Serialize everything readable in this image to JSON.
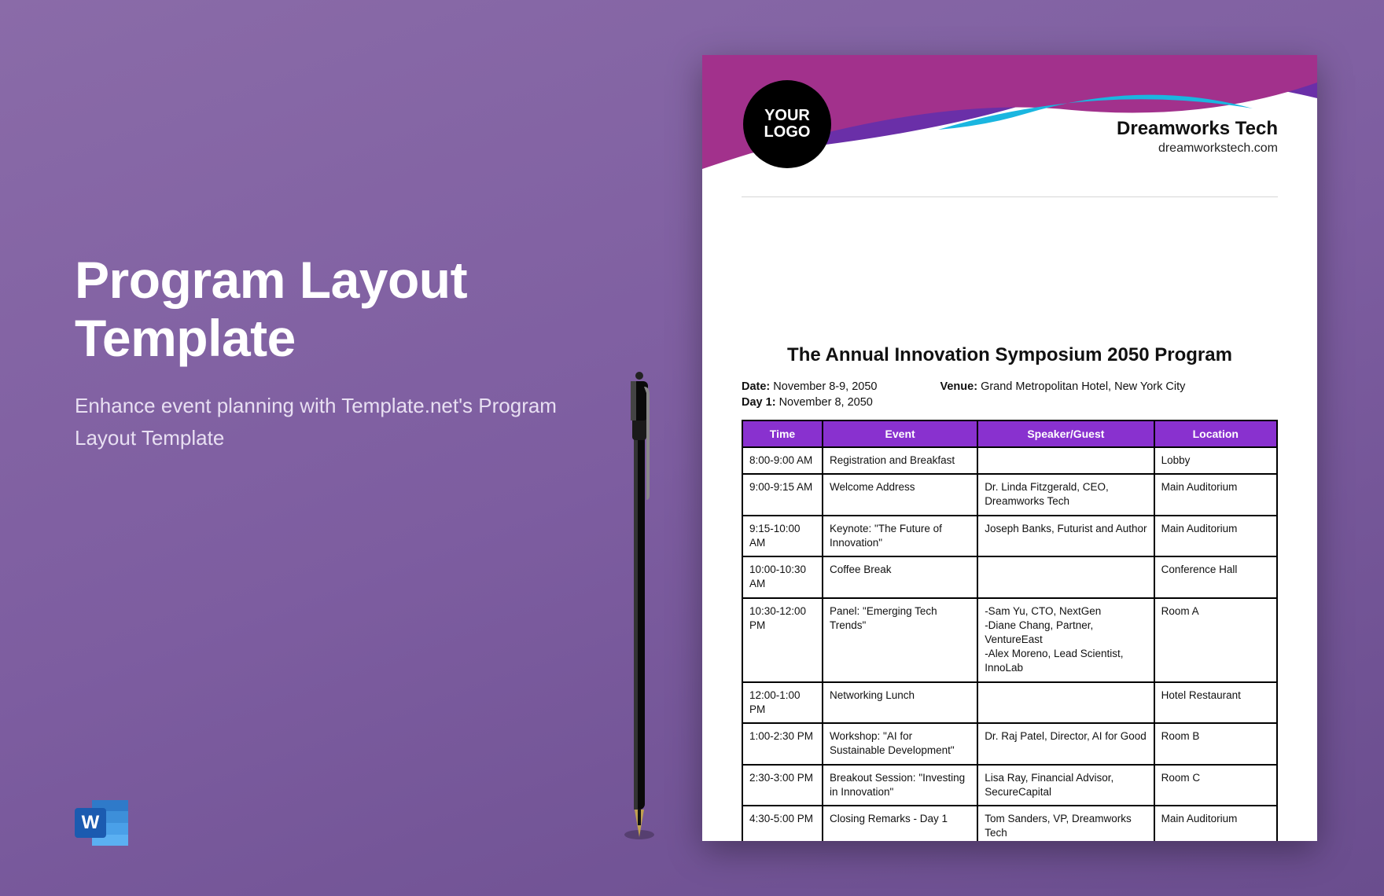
{
  "hero": {
    "title": "Program Layout Template",
    "subtitle": "Enhance event planning with Template.net's Program Layout Template"
  },
  "logo_placeholder": {
    "line1": "YOUR",
    "line2": "LOGO"
  },
  "company": {
    "name": "Dreamworks Tech",
    "site": "dreamworkstech.com"
  },
  "doc": {
    "title": "The Annual Innovation Symposium 2050 Program",
    "date_label": "Date:",
    "date_value": "November 8-9, 2050",
    "venue_label": "Venue:",
    "venue_value": "Grand Metropolitan Hotel, New York City",
    "day_label": "Day 1:",
    "day_value": "November 8, 2050"
  },
  "table": {
    "headers": {
      "time": "Time",
      "event": "Event",
      "speaker": "Speaker/Guest",
      "location": "Location"
    },
    "rows": [
      {
        "time": "8:00-9:00 AM",
        "event": "Registration and Breakfast",
        "speaker": "",
        "location": "Lobby"
      },
      {
        "time": "9:00-9:15 AM",
        "event": "Welcome Address",
        "speaker": "Dr. Linda Fitzgerald, CEO, Dreamworks Tech",
        "location": "Main Auditorium"
      },
      {
        "time": "9:15-10:00 AM",
        "event": "Keynote: \"The Future of Innovation\"",
        "speaker": "Joseph Banks, Futurist and Author",
        "location": "Main Auditorium"
      },
      {
        "time": "10:00-10:30 AM",
        "event": "Coffee Break",
        "speaker": "",
        "location": "Conference Hall"
      },
      {
        "time": "10:30-12:00 PM",
        "event": "Panel: \"Emerging Tech Trends\"",
        "speaker": "-Sam Yu, CTO, NextGen\n-Diane Chang, Partner, VentureEast\n-Alex Moreno, Lead Scientist, InnoLab",
        "location": "Room A"
      },
      {
        "time": "12:00-1:00 PM",
        "event": "Networking Lunch",
        "speaker": "",
        "location": "Hotel Restaurant"
      },
      {
        "time": "1:00-2:30 PM",
        "event": "Workshop: \"AI for Sustainable Development\"",
        "speaker": "Dr. Raj Patel, Director, AI for Good",
        "location": "Room B"
      },
      {
        "time": "2:30-3:00 PM",
        "event": "Breakout Session: \"Investing in Innovation\"",
        "speaker": "Lisa Ray, Financial Advisor, SecureCapital",
        "location": "Room C"
      },
      {
        "time": "4:30-5:00 PM",
        "event": "Closing Remarks - Day 1",
        "speaker": "Tom Sanders, VP, Dreamworks Tech",
        "location": "Main Auditorium"
      }
    ]
  }
}
